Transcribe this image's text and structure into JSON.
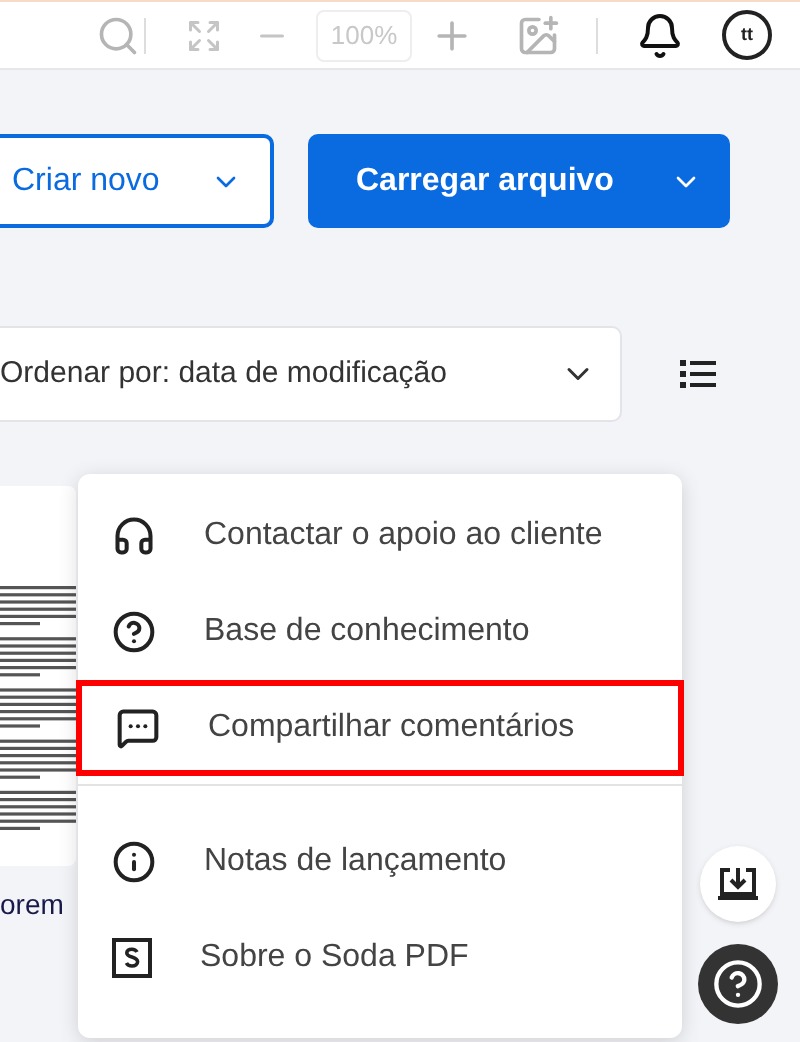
{
  "toolbar": {
    "zoom": "100%",
    "avatar": "tt"
  },
  "actions": {
    "create": "Criar novo",
    "upload": "Carregar arquivo"
  },
  "sort": {
    "label": "Ordenar por: data de modificação"
  },
  "file": {
    "name": "orem"
  },
  "menu": [
    {
      "kind": "headset",
      "label": "Contactar o apoio ao cliente",
      "highlighted": false,
      "divider_after": false
    },
    {
      "kind": "question",
      "label": "Base de conhecimento",
      "highlighted": false,
      "divider_after": false
    },
    {
      "kind": "comment",
      "label": "Compartilhar comentários",
      "highlighted": true,
      "divider_after": true
    },
    {
      "kind": "info",
      "label": "Notas de lançamento",
      "highlighted": false,
      "divider_after": false
    },
    {
      "kind": "logo",
      "label": "Sobre o Soda PDF",
      "highlighted": false,
      "divider_after": false
    }
  ]
}
